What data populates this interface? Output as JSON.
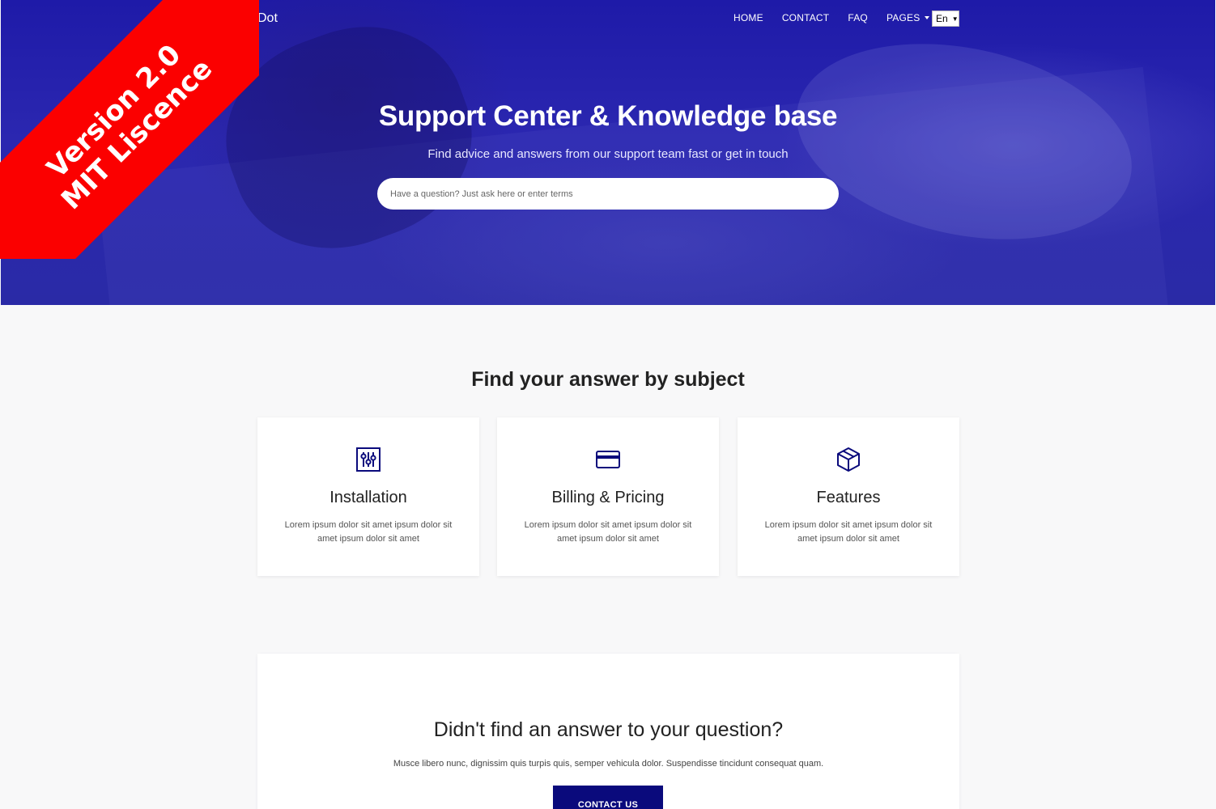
{
  "ribbon": {
    "line1": "Version 2.0",
    "line2": "MIT Liscence"
  },
  "nav": {
    "brand": "Dot",
    "items": [
      {
        "label": "HOME"
      },
      {
        "label": "CONTACT"
      },
      {
        "label": "FAQ"
      },
      {
        "label": "PAGES"
      }
    ],
    "language": "En"
  },
  "hero": {
    "title": "Support Center & Knowledge base",
    "subtitle": "Find advice and answers from our support team fast or get in touch",
    "search_placeholder": "Have a question? Just ask here or enter terms"
  },
  "subjects": {
    "title": "Find your answer by subject",
    "cards": [
      {
        "title": "Installation",
        "text": "Lorem ipsum dolor sit amet ipsum dolor sit amet ipsum dolor sit amet",
        "icon": "sliders-icon"
      },
      {
        "title": "Billing & Pricing",
        "text": "Lorem ipsum dolor sit amet ipsum dolor sit amet ipsum dolor sit amet",
        "icon": "credit-card-icon"
      },
      {
        "title": "Features",
        "text": "Lorem ipsum dolor sit amet ipsum dolor sit amet ipsum dolor sit amet",
        "icon": "box-icon"
      }
    ]
  },
  "contact": {
    "title": "Didn't find an answer to your question?",
    "text": "Musce libero nunc, dignissim quis turpis quis, semper vehicula dolor. Suspendisse tincidunt consequat quam.",
    "button_label": "CONTACT US"
  },
  "colors": {
    "primary": "#0a0a7c",
    "hero": "#2a27ae",
    "ribbon": "#fb0000",
    "background": "#f8f8f9"
  }
}
